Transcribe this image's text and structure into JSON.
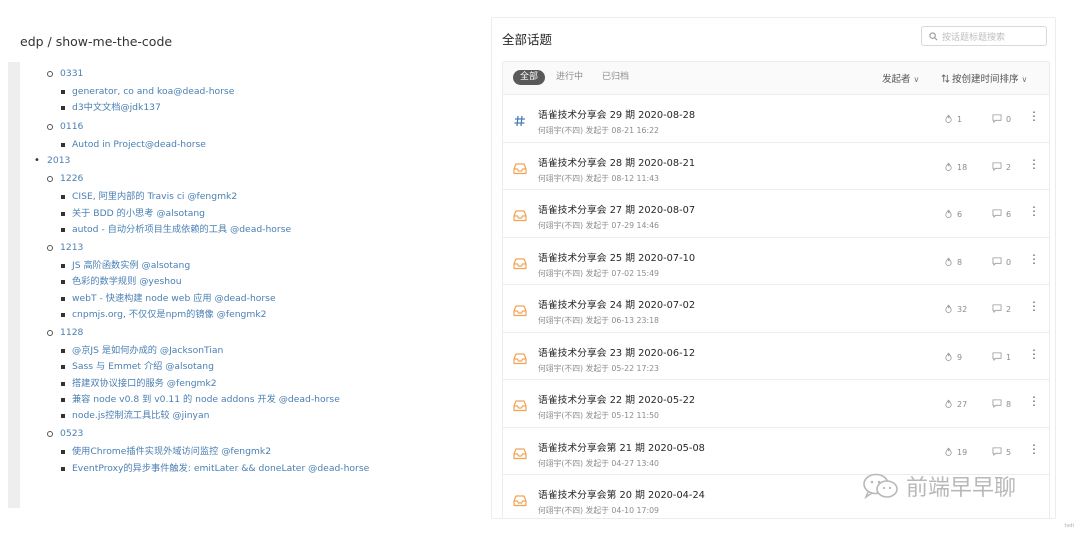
{
  "left": {
    "repo_title": "edp / show-me-the-code",
    "tree": [
      {
        "type": "month",
        "label": "0331"
      },
      {
        "type": "item",
        "label": "generator, co and koa@dead-horse"
      },
      {
        "type": "item",
        "label": "d3中文文档@jdk137"
      },
      {
        "type": "month",
        "label": "0116"
      },
      {
        "type": "item",
        "label": "Autod in Project@dead-horse"
      },
      {
        "type": "year",
        "label": "2013"
      },
      {
        "type": "month",
        "label": "1226"
      },
      {
        "type": "item",
        "label": "CISE, 阿里内部的 Travis ci @fengmk2"
      },
      {
        "type": "item",
        "label": "关于 BDD 的小思考 @alsotang"
      },
      {
        "type": "item",
        "label": "autod - 自动分析项目生成依赖的工具 @dead-horse"
      },
      {
        "type": "month",
        "label": "1213"
      },
      {
        "type": "item",
        "label": "JS 高阶函数实例 @alsotang"
      },
      {
        "type": "item",
        "label": "色彩的数学规则 @yeshou"
      },
      {
        "type": "item",
        "label": "webT - 快速构建 node web 应用 @dead-horse"
      },
      {
        "type": "item",
        "label": "cnpmjs.org, 不仅仅是npm的镜像 @fengmk2"
      },
      {
        "type": "month",
        "label": "1128"
      },
      {
        "type": "item",
        "label": "@京JS 是如何办成的 @JacksonTian"
      },
      {
        "type": "item",
        "label": "Sass 与 Emmet 介绍 @alsotang"
      },
      {
        "type": "item",
        "label": "搭建双协议接口的服务 @fengmk2"
      },
      {
        "type": "item",
        "label": "兼容 node v0.8 到 v0.11 的 node addons 开发 @dead-horse"
      },
      {
        "type": "item",
        "label": "node.js控制流工具比较 @jinyan"
      },
      {
        "type": "month",
        "label": "0523"
      },
      {
        "type": "item",
        "label": "使用Chrome插件实现外域访问监控 @fengmk2"
      },
      {
        "type": "item",
        "label": "EventProxy的异步事件触发: emitLater && doneLater @dead-horse"
      }
    ]
  },
  "right": {
    "title": "全部话题",
    "search_placeholder": "按话题标题搜索",
    "tabs": [
      "全部",
      "进行中",
      "已归档"
    ],
    "active_tab": 0,
    "filter_initiator": "发起者",
    "filter_sort": "按创建时间排序",
    "topics": [
      {
        "icon": "hash",
        "title": "语雀技术分享会 29 期 2020-08-28",
        "meta": "何翊宇(不四) 发起于 08-21 16:22",
        "likes": "1",
        "comments": "0"
      },
      {
        "icon": "inbox",
        "title": "语雀技术分享会 28 期 2020-08-21",
        "meta": "何翊宇(不四) 发起于 08-12 11:43",
        "likes": "18",
        "comments": "2"
      },
      {
        "icon": "inbox",
        "title": "语雀技术分享会 27 期 2020-08-07",
        "meta": "何翊宇(不四) 发起于 07-29 14:46",
        "likes": "6",
        "comments": "6"
      },
      {
        "icon": "inbox",
        "title": "语雀技术分享会 25 期 2020-07-10",
        "meta": "何翊宇(不四) 发起于 07-02 15:49",
        "likes": "8",
        "comments": "0"
      },
      {
        "icon": "inbox",
        "title": "语雀技术分享会 24 期 2020-07-02",
        "meta": "何翊宇(不四) 发起于 06-13 23:18",
        "likes": "32",
        "comments": "2"
      },
      {
        "icon": "inbox",
        "title": "语雀技术分享会 23 期 2020-06-12",
        "meta": "何翊宇(不四) 发起于 05-22 17:23",
        "likes": "9",
        "comments": "1"
      },
      {
        "icon": "inbox",
        "title": "语雀技术分享会 22 期 2020-05-22",
        "meta": "何翊宇(不四) 发起于 05-12 11:50",
        "likes": "27",
        "comments": "8"
      },
      {
        "icon": "inbox",
        "title": "语雀技术分享会第 21 期 2020-05-08",
        "meta": "何翊宇(不四) 发起于 04-27 13:40",
        "likes": "19",
        "comments": "5"
      },
      {
        "icon": "inbox",
        "title": "语雀技术分享会第 20 期 2020-04-24",
        "meta": "何翊宇(不四) 发起于 04-10 17:09",
        "likes": "",
        "comments": ""
      }
    ],
    "colors": {
      "accent_orange": "#f0a355",
      "hash_blue": "#4a7fb3",
      "active_tab_bg": "#595959"
    }
  },
  "watermark": {
    "text": "前端早早聊"
  },
  "corner_mark": "tvdi"
}
